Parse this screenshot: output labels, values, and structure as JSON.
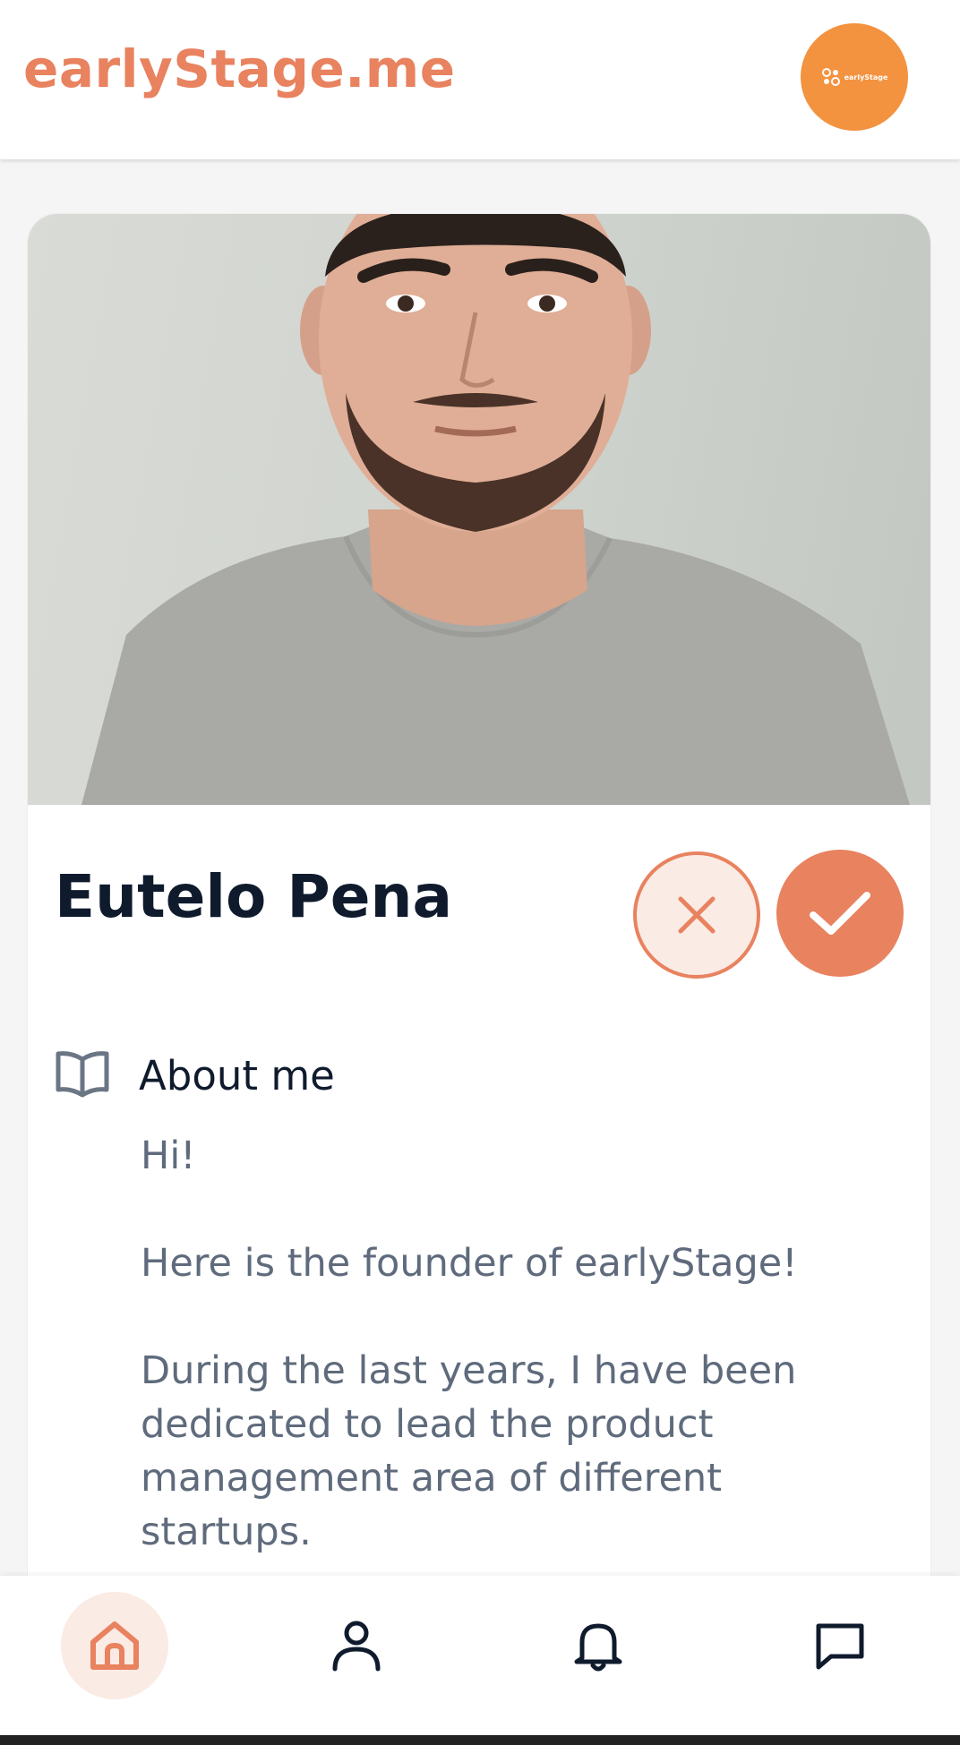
{
  "header": {
    "brand": "earlyStage.me",
    "avatar_logo_text": "earlyStage"
  },
  "profile": {
    "name": "Eutelo Pena",
    "photo_alt": "Profile photo"
  },
  "about": {
    "title": "About me",
    "paragraphs": [
      "Hi!",
      "Here is the founder of earlyStage!",
      "During the last years, I have been dedicated to lead the product management area of different startups."
    ]
  },
  "nav": {
    "active": "home"
  },
  "colors": {
    "accent": "#e8825f",
    "accent_light": "#faebe4",
    "avatar_bg": "#f3923f",
    "title_text": "#0f1b2d",
    "body_text": "#5f6b7c"
  }
}
